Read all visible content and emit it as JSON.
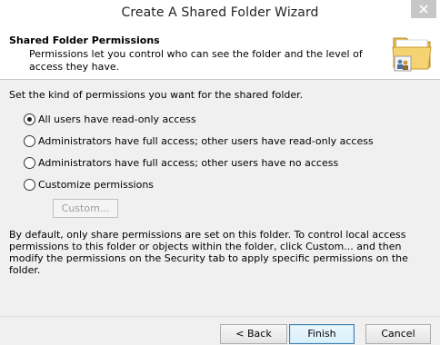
{
  "window": {
    "title": "Create A Shared Folder Wizard"
  },
  "header": {
    "title": "Shared Folder Permissions",
    "description": "Permissions let you control who can see the folder and the level of access they have.",
    "icon": "shared-folder-icon"
  },
  "main": {
    "intro": "Set the kind of permissions you want for the shared folder.",
    "options": [
      {
        "label": "All users have read-only access",
        "checked": true
      },
      {
        "label": "Administrators have full access; other users have read-only access",
        "checked": false
      },
      {
        "label": "Administrators have full access; other users have no access",
        "checked": false
      },
      {
        "label": "Customize permissions",
        "checked": false
      }
    ],
    "custom_button": "Custom...",
    "note": "By default, only share permissions are set on this folder. To control local access permissions to this folder or objects within the folder, click Custom... and then modify the permissions on the Security tab to apply specific permissions on the folder."
  },
  "footer": {
    "back": "< Back",
    "finish": "Finish",
    "cancel": "Cancel"
  }
}
